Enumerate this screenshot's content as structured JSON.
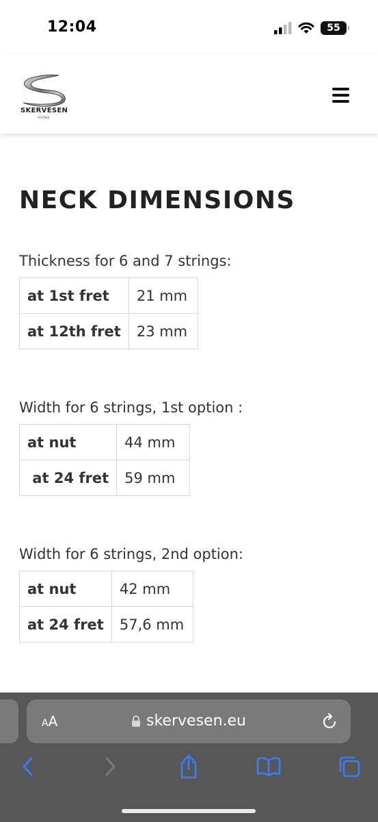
{
  "status_bar": {
    "time": "12:04",
    "battery": "55"
  },
  "site": {
    "logo_text": "SKERVESEN",
    "logo_subtext": "GUITARS"
  },
  "page": {
    "title": "NECK DIMENSIONS"
  },
  "sections": [
    {
      "caption": "Thickness for 6 and 7 strings:",
      "rows": [
        {
          "label": "at 1st fret",
          "value": "21 mm"
        },
        {
          "label": "at 12th fret",
          "value": "23 mm"
        }
      ]
    },
    {
      "caption": "Width for 6 strings, 1st option :",
      "rows": [
        {
          "label": "at nut",
          "value": "44 mm"
        },
        {
          "label": " at 24 fret",
          "value": "59 mm"
        }
      ]
    },
    {
      "caption": "Width for 6 strings, 2nd option:",
      "rows": [
        {
          "label": "at nut",
          "value": "42 mm"
        },
        {
          "label": "at 24 fret",
          "value": "57,6 mm"
        }
      ]
    }
  ],
  "browser": {
    "text_size_label_small": "A",
    "text_size_label_large": "A",
    "url": "skervesen.eu",
    "accent_color": "#3a7ef6"
  }
}
